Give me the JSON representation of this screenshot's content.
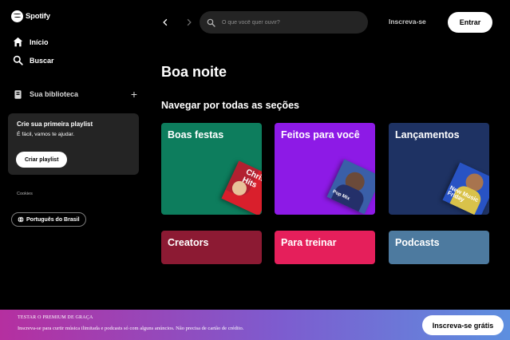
{
  "app": {
    "brand": "Spotify"
  },
  "sidebar": {
    "nav": [
      {
        "label": "Início",
        "icon": "home-icon"
      },
      {
        "label": "Buscar",
        "icon": "search-icon"
      }
    ],
    "library": {
      "label": "Sua biblioteca",
      "icon": "library-icon",
      "add_icon": "plus-icon"
    },
    "playlist_card": {
      "title": "Crie sua primeira playlist",
      "subtitle": "É fácil, vamos te ajudar.",
      "button": "Criar playlist"
    },
    "cookies": "Cookies",
    "language_button": "Português do Brasil"
  },
  "topbar": {
    "search_placeholder": "O que você quer ouvir?",
    "signup": "Inscreva-se",
    "login": "Entrar"
  },
  "main": {
    "greeting": "Boa noite",
    "section_title": "Navegar por todas as seções",
    "categories": [
      {
        "title": "Boas festas",
        "color": "#0d7d5d",
        "art_text": "Christmas Hits"
      },
      {
        "title": "Feitos para você",
        "color": "#8d1ae6",
        "art_text": "Pop Mix"
      },
      {
        "title": "Lançamentos",
        "color": "#1e3263",
        "art_text": "New Music Friday"
      },
      {
        "title": "Creators",
        "color": "#8c1a33"
      },
      {
        "title": "Para treinar",
        "color": "#e51f5b"
      },
      {
        "title": "Podcasts",
        "color": "#4d7a9f"
      }
    ]
  },
  "banner": {
    "title": "TESTAR O PREMIUM DE GRAÇA",
    "subtitle": "Inscreva-se para curtir música ilimitada e podcasts só com alguns anúncios. Não precisa de cartão de crédito.",
    "button": "Inscreva-se grátis"
  },
  "colors": {
    "accent_green": "#1ed760",
    "background": "#000000",
    "card": "#242424"
  }
}
